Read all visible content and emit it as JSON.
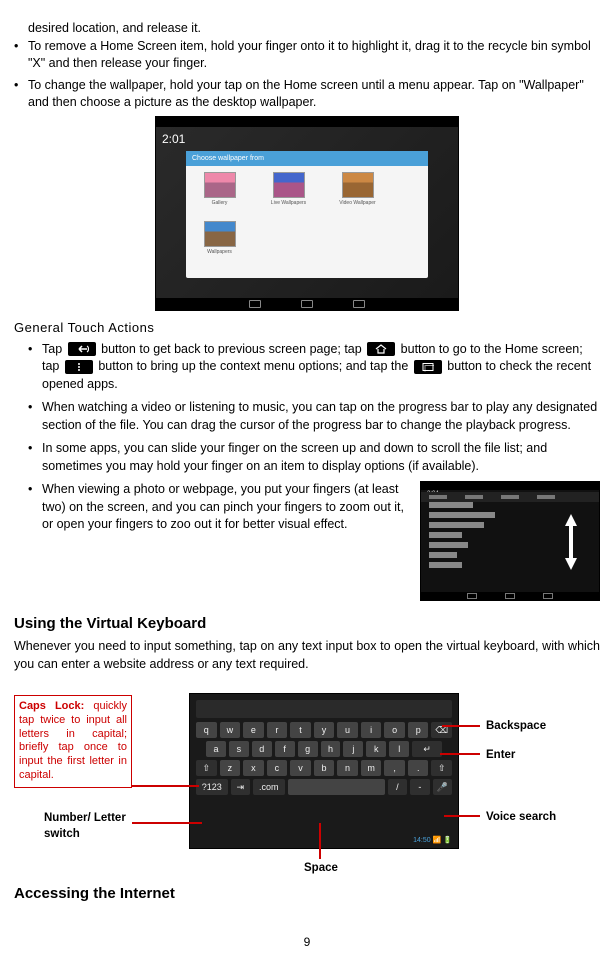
{
  "intro": {
    "line1": "desired location, and release it.",
    "bullet2": "To remove a Home Screen item, hold your finger onto it to highlight it, drag it to the recycle bin symbol \"X\" and then release your finger.",
    "bullet3": "To change the wallpaper, hold your tap on the Home screen until a menu appear. Tap on \"Wallpaper\" and then choose a picture as the desktop wallpaper."
  },
  "wallpaper_dialog": {
    "title": "Choose wallpaper from",
    "items": [
      "Gallery",
      "Live Wallpapers",
      "Video Wallpaper",
      "Wallpapers"
    ],
    "clock": "2:01"
  },
  "general": {
    "heading": "General Touch Actions",
    "b1a": "Tap ",
    "b1b": " button to get back to previous screen page; tap ",
    "b1c": " button to go to the Home screen; tap ",
    "b1d": " button to bring up the context menu options; and tap the ",
    "b1e": " button to check the recent opened apps.",
    "b2": "When watching a video or listening to music, you can tap on the progress bar to play any designated section of the file. You can drag the cursor of the progress bar to change the playback progress.",
    "b3": "In some apps, you can slide your finger on the screen up and down to scroll the file list; and sometimes you may hold your finger on an item to display options (if available).",
    "b4": "When viewing a photo or webpage, you put your fingers (at least two) on the screen, and you can pinch your fingers to zoom out it, or open your fingers to zoo out it for better visual effect."
  },
  "vk": {
    "heading": "Using the Virtual Keyboard",
    "para": "Whenever you need to input something, tap on any text input box to open the virtual keyboard, with which you can enter a website address or any text required."
  },
  "kb": {
    "caps_label": "Caps Lock:",
    "caps_text": " quickly tap twice to input all letters in capital; briefly tap once to input the first letter in capital.",
    "numletter": "Number/ Letter switch",
    "rows": {
      "r1": [
        "q",
        "w",
        "e",
        "r",
        "t",
        "y",
        "u",
        "i",
        "o",
        "p",
        "⌫"
      ],
      "r2": [
        "a",
        "s",
        "d",
        "f",
        "g",
        "h",
        "j",
        "k",
        "l",
        "↵"
      ],
      "r3": [
        "⇧",
        "z",
        "x",
        "c",
        "v",
        "b",
        "n",
        "m",
        ",",
        ".",
        "⇧"
      ],
      "r4": [
        "?123",
        "⇥",
        ".com",
        "",
        "/",
        "-",
        "🎤"
      ]
    },
    "time": "14:50",
    "labels": {
      "backspace": "Backspace",
      "enter": "Enter",
      "voice": "Voice search",
      "space": "Space"
    }
  },
  "accessing": {
    "heading": "Accessing the Internet"
  },
  "page_num": "9"
}
